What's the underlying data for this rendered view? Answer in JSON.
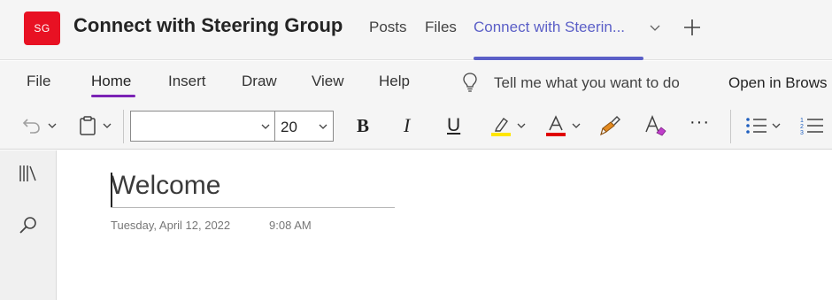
{
  "colors": {
    "avatar_bg": "#e81123",
    "accent": "#5b5fc7",
    "home_underline": "#7b23b5",
    "highlight_yellow": "#ffe600",
    "font_color_red": "#e00000",
    "brush_orange": "#e38a20",
    "eraser_pink": "#c03ecb"
  },
  "team": {
    "avatar_initials": "SG",
    "title": "Connect with Steering Group"
  },
  "header_tabs": {
    "posts": "Posts",
    "files": "Files",
    "active": "Connect with Steerin...",
    "dropdown_icon": "chevron-down-icon",
    "add_icon": "plus-icon"
  },
  "ribbon": {
    "tabs": {
      "file": "File",
      "home": "Home",
      "insert": "Insert",
      "draw": "Draw",
      "view": "View",
      "help": "Help"
    },
    "tell_me": "Tell me what you want to do",
    "open_in_browser": "Open in Brows",
    "font_name": "",
    "font_size": "20",
    "bold": "B",
    "italic": "I",
    "underline": "U",
    "more": "···",
    "icons": [
      "undo-icon",
      "clipboard-icon",
      "highlighter-icon",
      "font-color-icon",
      "format-painter-icon",
      "clear-formatting-icon",
      "bullet-list-icon",
      "numbered-list-icon",
      "lightbulb-icon"
    ]
  },
  "rail": {
    "icons": [
      "notebooks-icon",
      "search-icon"
    ]
  },
  "page": {
    "title": "Welcome",
    "date": "Tuesday, April 12, 2022",
    "time": "9:08 AM"
  }
}
